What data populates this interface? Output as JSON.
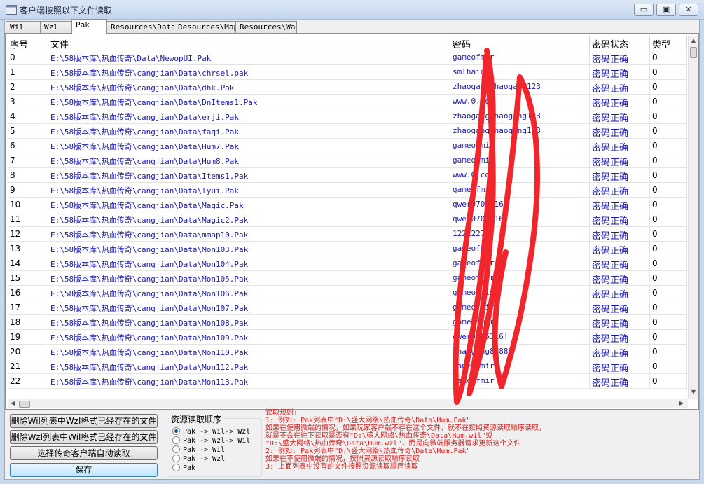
{
  "window": {
    "title": "客户端按照以下文件读取",
    "controls": {
      "minimize": "▭",
      "maximize": "▣",
      "close": "✕"
    }
  },
  "tabs": [
    {
      "label": "Wil",
      "active": false
    },
    {
      "label": "Wzl",
      "active": false
    },
    {
      "label": "Pak",
      "active": true
    },
    {
      "label": "Resources\\Data",
      "active": false
    },
    {
      "label": "Resources\\Map",
      "active": false
    },
    {
      "label": "Resources\\Wav",
      "active": false
    }
  ],
  "table": {
    "columns": [
      "序号",
      "文件",
      "密码",
      "密码状态",
      "类型"
    ],
    "rows": [
      [
        "0",
        "E:\\58版本库\\热血传奇\\Data\\NewopUI.Pak",
        "gameofmir",
        "密码正确",
        "0"
      ],
      [
        "1",
        "E:\\58版本库\\热血传奇\\cangjian\\Data\\chrsel.pak",
        "smlhaids",
        "密码正确",
        "0"
      ],
      [
        "2",
        "E:\\58版本库\\热血传奇\\cangjian\\Data\\dhk.Pak",
        "zhaogangzhaogang123",
        "密码正确",
        "0"
      ],
      [
        "3",
        "E:\\58版本库\\热血传奇\\cangjian\\Data\\DnItems1.Pak",
        "www.0.com",
        "密码正确",
        "0"
      ],
      [
        "4",
        "E:\\58版本库\\热血传奇\\cangjian\\Data\\erji.Pak",
        "zhaogangzhaogang123",
        "密码正确",
        "0"
      ],
      [
        "5",
        "E:\\58版本库\\热血传奇\\cangjian\\Data\\faqi.Pak",
        "zhaogangzhaogang123",
        "密码正确",
        "0"
      ],
      [
        "6",
        "E:\\58版本库\\热血传奇\\cangjian\\Data\\Hum7.Pak",
        "gameofmir",
        "密码正确",
        "0"
      ],
      [
        "7",
        "E:\\58版本库\\热血传奇\\cangjian\\Data\\Hum8.Pak",
        "gameofmir",
        "密码正确",
        "0"
      ],
      [
        "8",
        "E:\\58版本库\\热血传奇\\cangjian\\Data\\Items1.Pak",
        "www.0.com",
        "密码正确",
        "0"
      ],
      [
        "9",
        "E:\\58版本库\\热血传奇\\cangjian\\Data\\lyui.Pak",
        "gameofmir",
        "密码正确",
        "0"
      ],
      [
        "10",
        "E:\\58版本库\\热血传奇\\cangjian\\Data\\Magic.Pak",
        "qwer0706316!",
        "密码正确",
        "0"
      ],
      [
        "11",
        "E:\\58版本库\\热血传奇\\cangjian\\Data\\Magic2.Pak",
        "qwer0706316",
        "密码正确",
        "0"
      ],
      [
        "12",
        "E:\\58版本库\\热血传奇\\cangjian\\Data\\mmap10.Pak",
        "12212278",
        "密码正确",
        "0"
      ],
      [
        "13",
        "E:\\58版本库\\热血传奇\\cangjian\\Data\\Mon103.Pak",
        "gameofmir",
        "密码正确",
        "0"
      ],
      [
        "14",
        "E:\\58版本库\\热血传奇\\cangjian\\Data\\Mon104.Pak",
        "gameofmir",
        "密码正确",
        "0"
      ],
      [
        "15",
        "E:\\58版本库\\热血传奇\\cangjian\\Data\\Mon105.Pak",
        "gameofmir",
        "密码正确",
        "0"
      ],
      [
        "16",
        "E:\\58版本库\\热血传奇\\cangjian\\Data\\Mon106.Pak",
        "gameofmir",
        "密码正确",
        "0"
      ],
      [
        "17",
        "E:\\58版本库\\热血传奇\\cangjian\\Data\\Mon107.Pak",
        "gameofmir",
        "密码正确",
        "0"
      ],
      [
        "18",
        "E:\\58版本库\\热血传奇\\cangjian\\Data\\Mon108.Pak",
        "gameofmir",
        "密码正确",
        "0"
      ],
      [
        "19",
        "E:\\58版本库\\热血传奇\\cangjian\\Data\\Mon109.Pak",
        "qwer0706316!",
        "密码正确",
        "0"
      ],
      [
        "20",
        "E:\\58版本库\\热血传奇\\cangjian\\Data\\Mon110.Pak",
        "zhaogang88888",
        "密码正确",
        "0"
      ],
      [
        "21",
        "E:\\58版本库\\热血传奇\\cangjian\\Data\\Mon112.Pak",
        "gameofmir",
        "密码正确",
        "0"
      ],
      [
        "22",
        "E:\\58版本库\\热血传奇\\cangjian\\Data\\Mon113.Pak",
        "gameofmir",
        "密码正确",
        "0"
      ]
    ]
  },
  "buttons": {
    "delete_wil": "删除Wil列表中Wzl格式已经存在的文件",
    "delete_wzl": "删除Wzl列表中Wil格式已经存在的文件",
    "auto_read": "选择传奇客户端自动读取",
    "save": "保存"
  },
  "resource_order": {
    "title": "资源读取顺序",
    "selected_index": 0,
    "options": [
      "Pak -> Wil-> Wzl",
      "Pak -> Wzl-> Wil",
      "Pak -> Wil",
      "Pak -> Wzl",
      "Pak"
    ]
  },
  "rules": {
    "lines": [
      "读取规则:",
      "1: 例如: Pak列表中\"D:\\盛大网络\\热血传奇\\Data\\Hum.Pak\"",
      "   如果在使用微端的情况，如果玩家客户端不存在这个文件，就不在按照资源读取顺序读取，",
      "   就是不会在往下读取是否有\"D:\\盛大网络\\热血传奇\\Data\\Hum.wil\"或",
      "  \"D:\\盛大网络\\热血传奇\\Data\\Hum.wzl\"，而是向微端服务器请求更新这个文件",
      "2: 例如: Pak列表中\"D:\\盛大网络\\热血传奇\\Data\\Hum.Pak\"",
      "   如果在不使用微端的情况，按照资源读取顺序读取",
      "3: 上面列表中没有的文件按照资源读取顺序读取"
    ]
  },
  "colors": {
    "link_text": "#1a1ab0",
    "rules_text": "#d81e1e",
    "scribble": "#f0262c"
  }
}
